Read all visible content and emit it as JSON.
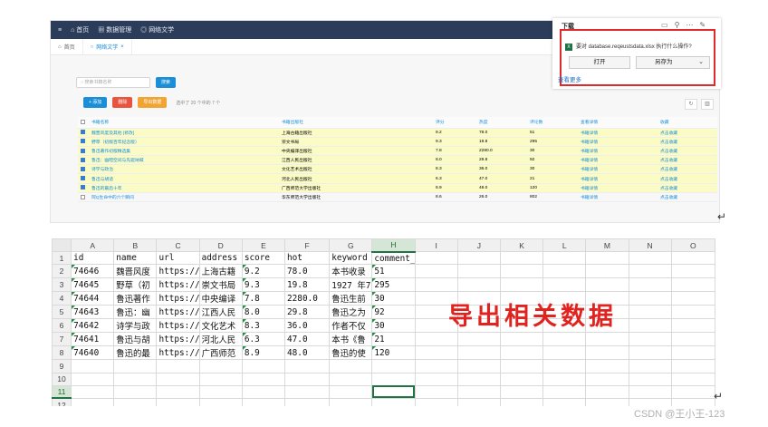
{
  "admin": {
    "nav": [
      "≡",
      "首页",
      "数据管理",
      "网络文学"
    ],
    "tabs": [
      "首页",
      "网络文学"
    ],
    "search_placeholder": "搜索书籍名称",
    "search_button": "搜索",
    "add_button": "+ 添加",
    "delete_button": "删除",
    "export_button": "导出数据",
    "selection_info": "选中了 20 个中的 7 个",
    "columns": [
      "书籍名称",
      "书籍出版社",
      "评分",
      "热度",
      "评论数",
      "查看详情",
      "收藏"
    ],
    "rows": [
      {
        "checked": true,
        "name": "魏晋风度及其他 [修改]",
        "publisher": "上海古籍出版社",
        "score": "9.2",
        "hot": "78.0",
        "comments": "51",
        "detail": "书籍详情",
        "fav": "点击收藏"
      },
      {
        "checked": true,
        "name": "野草（初版百年纪念版）",
        "publisher": "崇文书局",
        "score": "9.3",
        "hot": "19.8",
        "comments": "295",
        "detail": "书籍详情",
        "fav": "点击收藏"
      },
      {
        "checked": true,
        "name": "鲁迅著作初版精选集",
        "publisher": "中央编译出版社",
        "score": "7.8",
        "hot": "2280.0",
        "comments": "30",
        "detail": "书籍详情",
        "fav": "点击收藏"
      },
      {
        "checked": true,
        "name": "鲁迅：幽暗空间与先驱呐喊",
        "publisher": "江西人民出版社",
        "score": "8.0",
        "hot": "29.8",
        "comments": "92",
        "detail": "书籍详情",
        "fav": "点击收藏"
      },
      {
        "checked": true,
        "name": "诗学与政治",
        "publisher": "文化艺术出版社",
        "score": "8.3",
        "hot": "36.0",
        "comments": "30",
        "detail": "书籍详情",
        "fav": "点击收藏"
      },
      {
        "checked": true,
        "name": "鲁迅与胡适",
        "publisher": "河北人民出版社",
        "score": "6.3",
        "hot": "47.0",
        "comments": "21",
        "detail": "书籍详情",
        "fav": "点击收藏"
      },
      {
        "checked": true,
        "name": "鲁迅的最后十年",
        "publisher": "广西师范大学出版社",
        "score": "8.9",
        "hot": "48.0",
        "comments": "120",
        "detail": "书籍详情",
        "fav": "点击收藏"
      },
      {
        "checked": false,
        "name": "阿Q生命中的六个瞬间",
        "publisher": "华东师范大学出版社",
        "score": "8.6",
        "hot": "26.0",
        "comments": "802",
        "detail": "书籍详情",
        "fav": "点击收藏"
      }
    ]
  },
  "download": {
    "title": "下载",
    "question": "要对 database.reqeustsdata.xlsx 执行什么操作?",
    "open": "打开",
    "save_as": "另存为",
    "more": "查看更多",
    "file_icon": "X"
  },
  "sheet": {
    "col_letters": [
      "A",
      "B",
      "C",
      "D",
      "E",
      "F",
      "G",
      "H",
      "I",
      "J",
      "K",
      "L",
      "M",
      "N",
      "O"
    ],
    "row_numbers": [
      "1",
      "2",
      "3",
      "4",
      "5",
      "6",
      "7",
      "8",
      "9",
      "10",
      "11",
      "12"
    ],
    "header": [
      "id",
      "name",
      "url",
      "address",
      "score",
      "hot",
      "keyword",
      "comment_count"
    ],
    "rows": [
      [
        "74646",
        "魏晋风度",
        "https://",
        "上海古籍",
        "9.2",
        "78.0",
        "本书收录",
        "51"
      ],
      [
        "74645",
        "野草（初",
        "https://",
        "崇文书局",
        "9.3",
        "19.8",
        "1927 年7",
        "295"
      ],
      [
        "74644",
        "鲁迅著作",
        "https://",
        "中央编译",
        "7.8",
        "2280.0",
        "鲁迅生前",
        "30"
      ],
      [
        "74643",
        "鲁迅：幽",
        "https://",
        "江西人民",
        "8.0",
        "29.8",
        "鲁迅之为",
        "92"
      ],
      [
        "74642",
        "诗学与政",
        "https://",
        "文化艺术",
        "8.3",
        "36.0",
        "作者不仅",
        "30"
      ],
      [
        "74641",
        "鲁迅与胡",
        "https://",
        "河北人民",
        "6.3",
        "47.0",
        "本书《鲁",
        "21"
      ],
      [
        "74640",
        "鲁迅的最",
        "https://",
        "广西师范",
        "8.9",
        "48.0",
        "鲁迅的使",
        "120"
      ]
    ]
  },
  "annotation": "导出相关数据",
  "watermark": "CSDN @王小王-123",
  "colors": {
    "accent": "#1a8fd8",
    "highlight": "#fbfbc6",
    "annotation": "#e0231f",
    "excel_green": "#217346"
  }
}
